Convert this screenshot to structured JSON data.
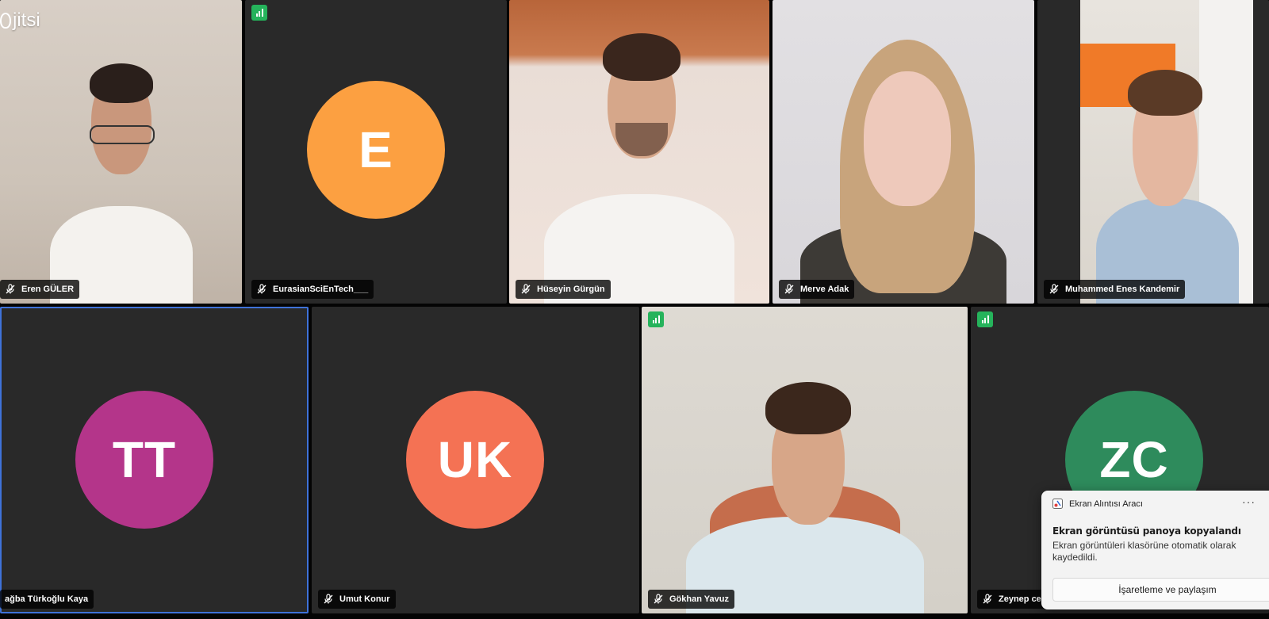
{
  "app": {
    "logo_text": "jitsi"
  },
  "participants": [
    {
      "name": "Eren GÜLER",
      "type": "video"
    },
    {
      "name": "EurasianSciEnTech___",
      "type": "avatar",
      "initials": "E",
      "avatar_color": "#fca041",
      "connection_indicator": true
    },
    {
      "name": "Hüseyin Gürgün",
      "type": "video"
    },
    {
      "name": "Merve Adak",
      "type": "video"
    },
    {
      "name": "Muhammed Enes Kandemir",
      "type": "video"
    },
    {
      "name": "ağba Türkoğlu Kaya",
      "type": "avatar",
      "initials": "TT",
      "avatar_color": "#b4358a",
      "active_speaker": true
    },
    {
      "name": "Umut Konur",
      "type": "avatar",
      "initials": "UK",
      "avatar_color": "#f47254"
    },
    {
      "name": "Gökhan Yavuz",
      "type": "video",
      "connection_indicator": true
    },
    {
      "name": "Zeynep cer",
      "type": "avatar",
      "initials": "ZC",
      "avatar_color": "#2e8b5c",
      "connection_indicator": true
    }
  ],
  "notification": {
    "app_name": "Ekran Alıntısı Aracı",
    "more": "···",
    "title": "Ekran görüntüsü panoya kopyalandı",
    "body": "Ekran görüntüleri klasörüne otomatik olarak kaydedildi.",
    "button_label": "İşaretleme ve paylaşım"
  },
  "colors": {
    "tile_background": "#292929",
    "active_speaker_border": "#3f72d9",
    "connection_good": "#25b35b"
  },
  "icons": {
    "mic": "mic-muted-icon",
    "connection": "connection-status-icon",
    "snip": "snipping-tool-icon"
  }
}
